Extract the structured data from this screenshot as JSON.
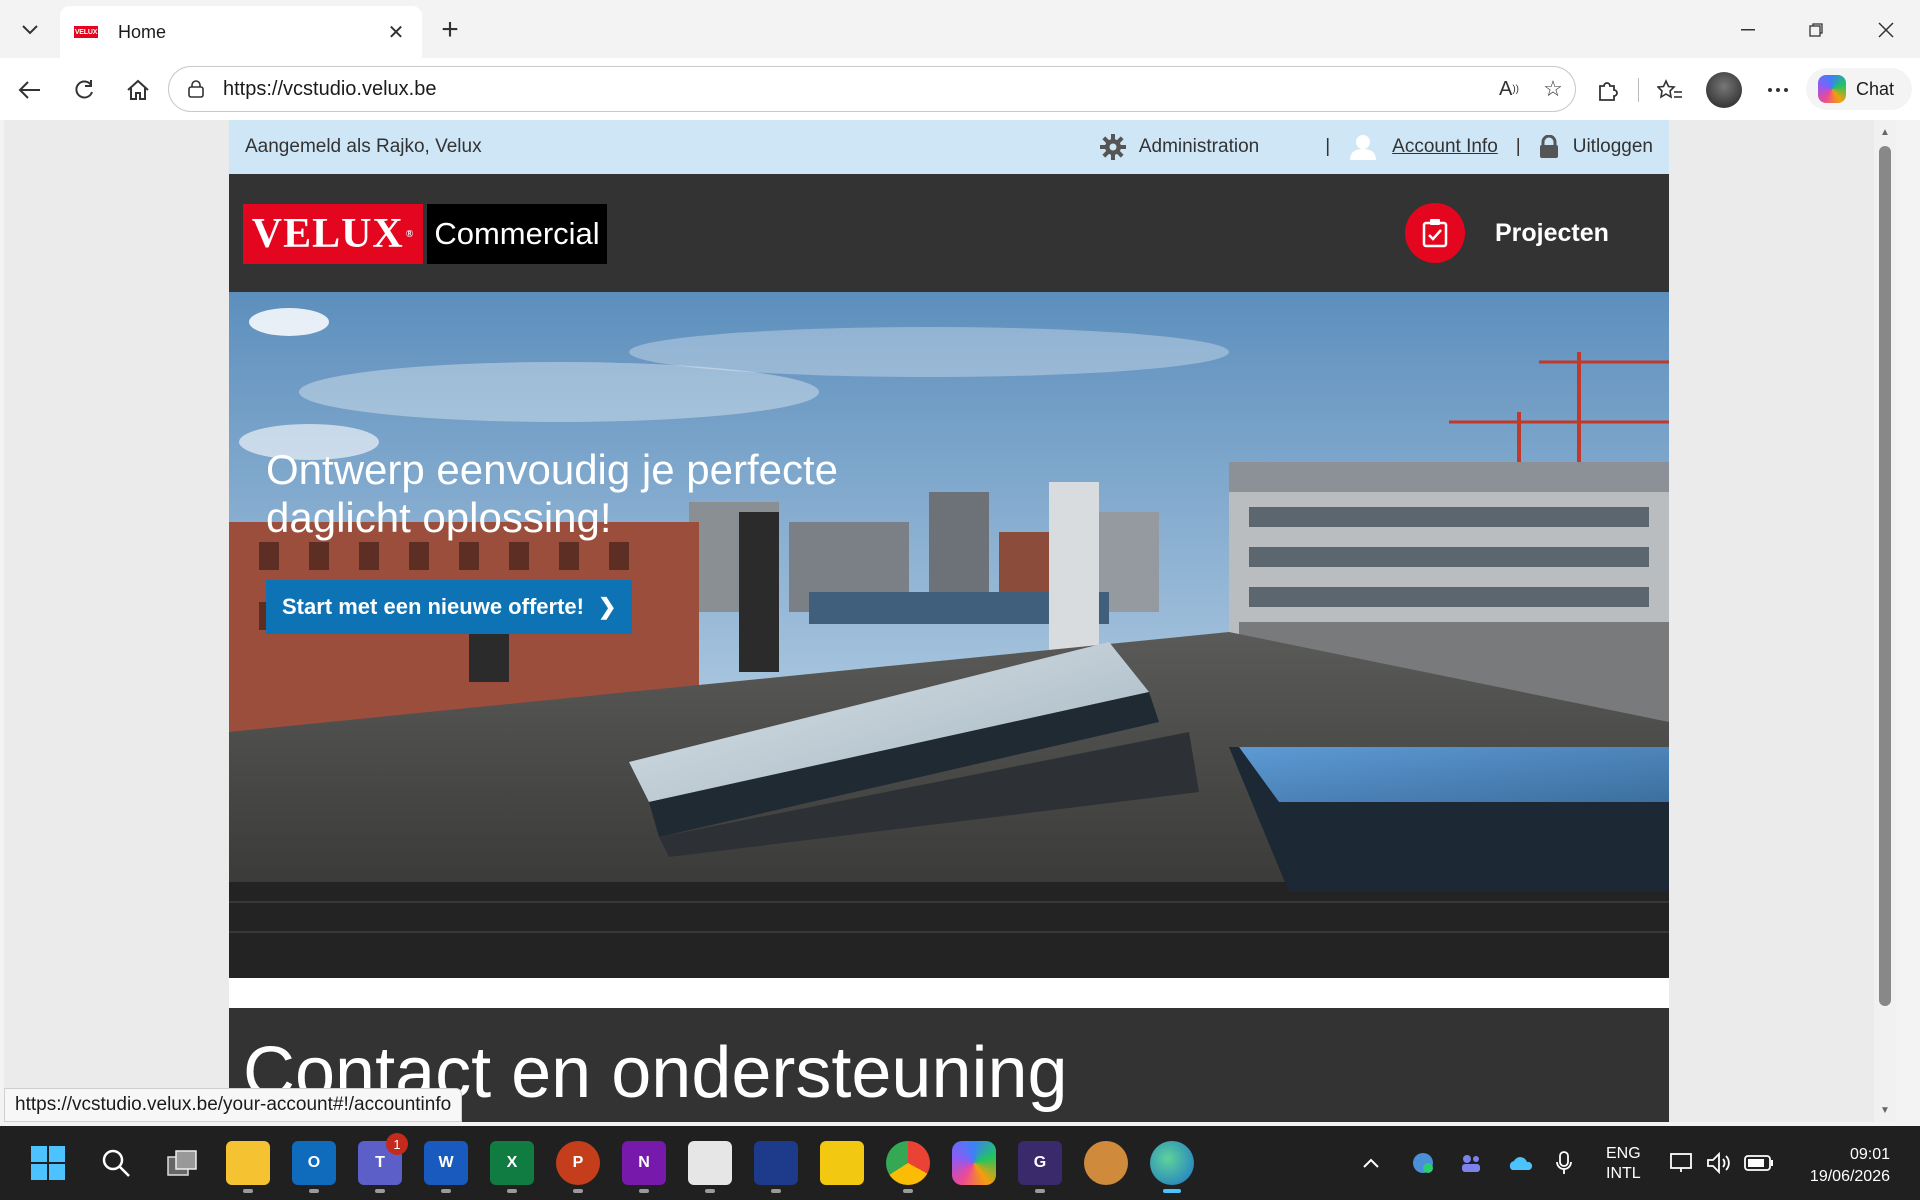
{
  "browser": {
    "tab_title": "Home",
    "favicon_text": "VELUX",
    "url": "https://vcstudio.velux.be",
    "copilot_label": "Chat"
  },
  "site": {
    "topbar": {
      "logged_in": "Aangemeld als Rajko, Velux",
      "admin": "Administration",
      "separator": "|",
      "account": "Account Info",
      "logout": "Uitloggen"
    },
    "logo": {
      "brand": "VELUX",
      "mark": "®",
      "sub": "Commercial"
    },
    "nav": {
      "projects": "Projecten"
    },
    "hero": {
      "heading": "Ontwerp eenvoudig je perfecte daglicht oplossing!",
      "cta": "Start met een nieuwe offerte!",
      "cta_arrow": "❯"
    },
    "contact": {
      "title": "Contact en ondersteuning"
    }
  },
  "status_bar": {
    "url": "https://vcstudio.velux.be/your-account#!/accountinfo"
  },
  "taskbar": {
    "teams_badge": "1",
    "lang_line1": "ENG",
    "lang_line2": "INTL",
    "time": "09:01",
    "date": "19/06/2026"
  },
  "colors": {
    "velux_red": "#e4051f",
    "cta_blue": "#0d73b4",
    "topbar_bg": "#cfe6f7",
    "header_bg": "#333333"
  }
}
